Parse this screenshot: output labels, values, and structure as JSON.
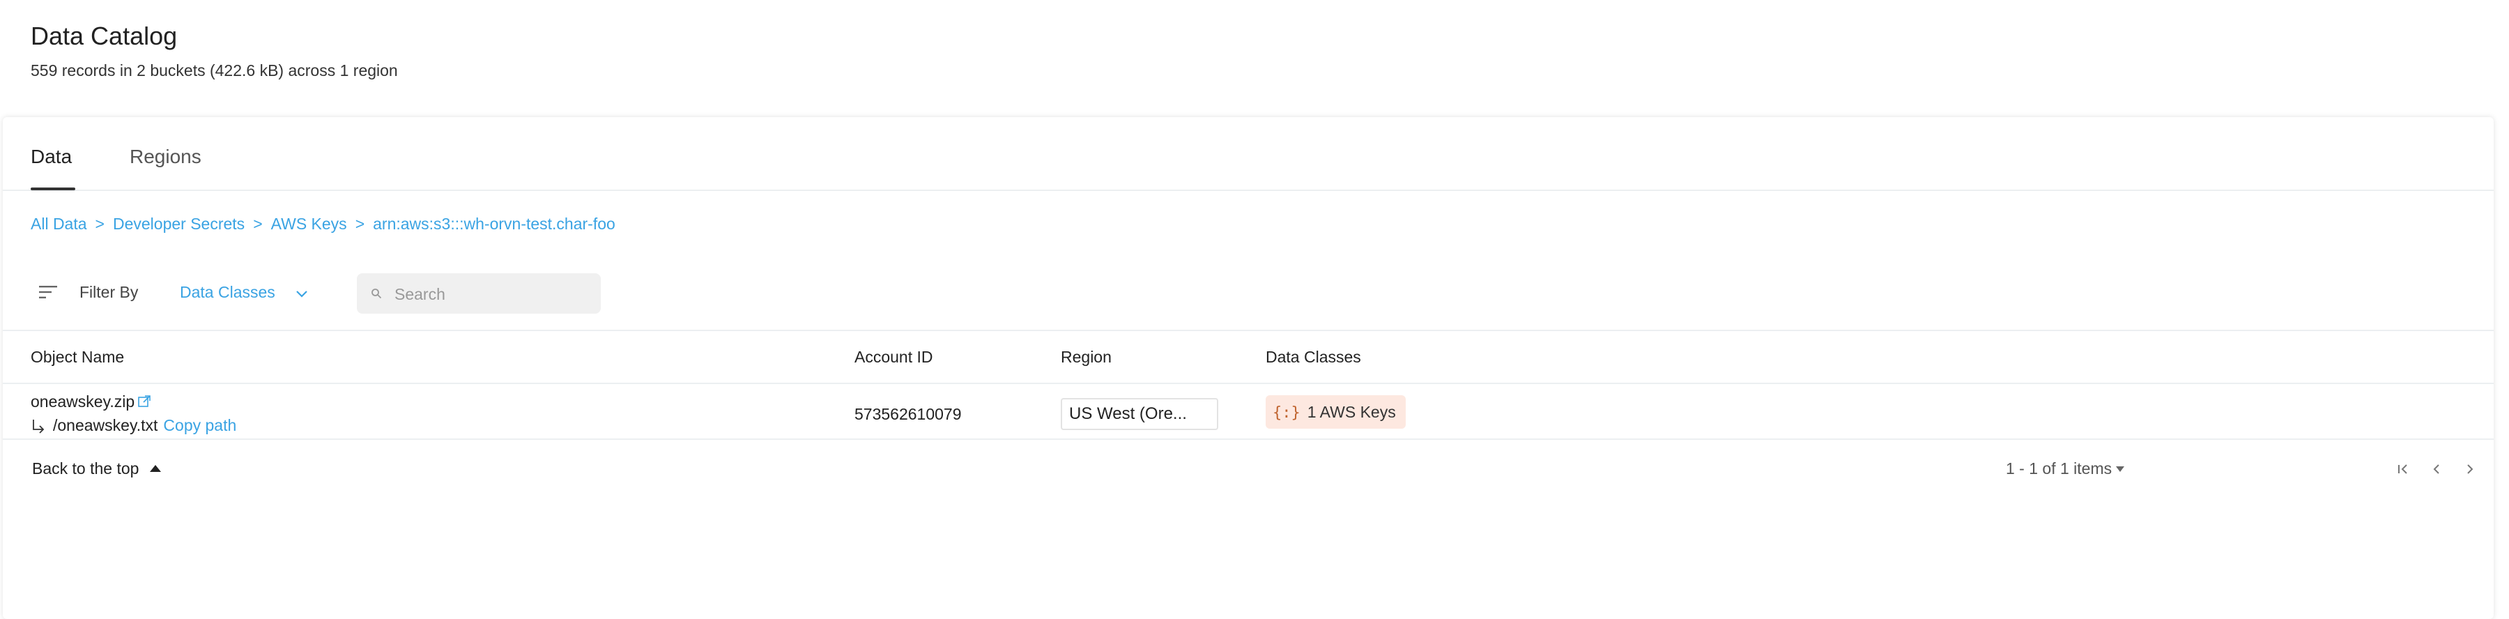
{
  "page": {
    "title": "Data Catalog",
    "subtitle": "559 records in 2 buckets (422.6 kB) across 1 region"
  },
  "tabs": [
    {
      "label": "Data",
      "active": true
    },
    {
      "label": "Regions",
      "active": false
    }
  ],
  "breadcrumb": {
    "items": [
      "All Data",
      "Developer Secrets",
      "AWS Keys",
      "arn:aws:s3:::wh-orvn-test.char-foo"
    ],
    "separator": ">"
  },
  "filter": {
    "label": "Filter By",
    "selected": "Data Classes",
    "search_placeholder": "Search"
  },
  "table": {
    "columns": [
      "Object Name",
      "Account ID",
      "Region",
      "Data Classes"
    ],
    "rows": [
      {
        "object_name": "oneawskey.zip",
        "sub_path": "/oneawskey.txt",
        "copy_label": "Copy path",
        "account_id": "573562610079",
        "region": "US West (Ore...",
        "data_class": {
          "icon_text": "{:}",
          "label": "1 AWS Keys"
        }
      }
    ]
  },
  "footer": {
    "back_to_top": "Back to the top",
    "pagination": "1 - 1 of 1 items"
  },
  "colors": {
    "accent": "#3aa3e3",
    "badge_bg": "#fde8e0",
    "badge_icon": "#c0642f"
  }
}
